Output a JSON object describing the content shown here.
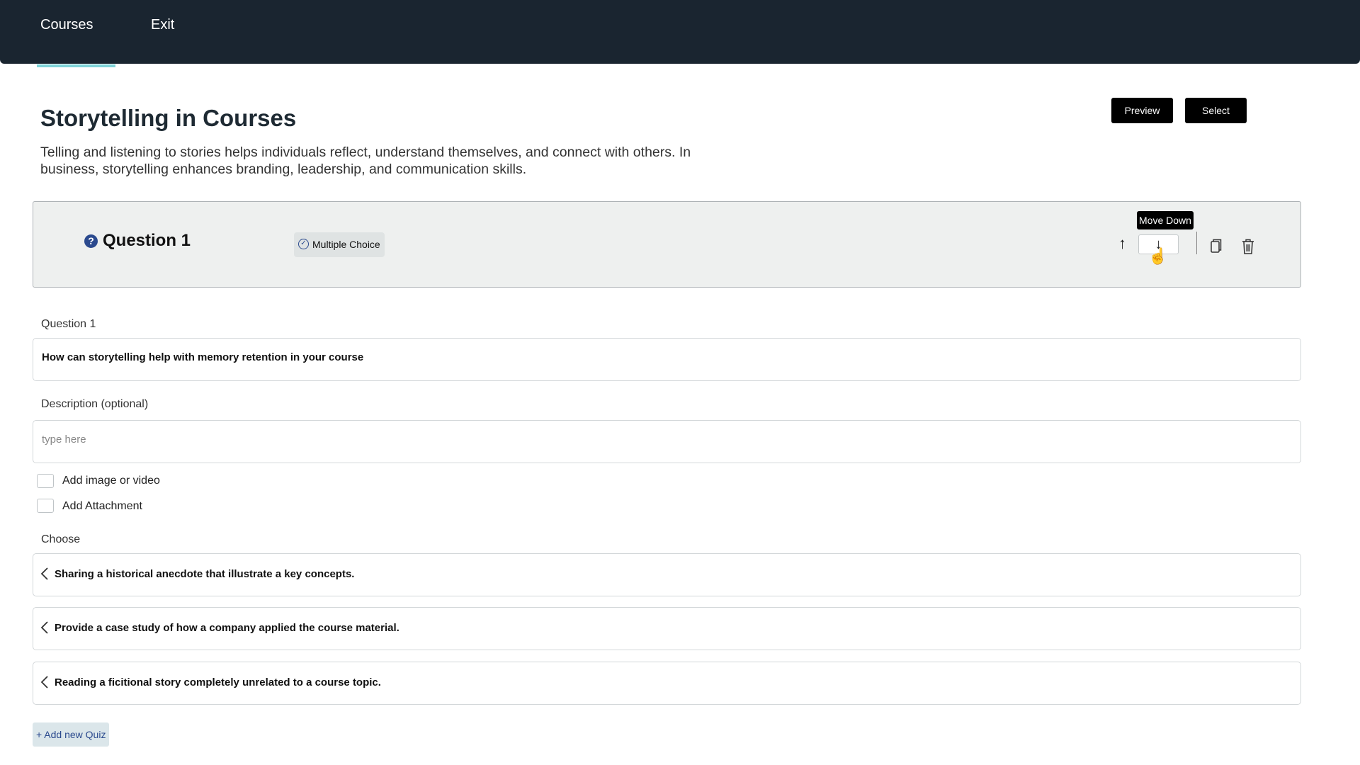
{
  "nav": {
    "courses": "Courses",
    "exit": "Exit"
  },
  "page": {
    "title": "Storytelling in Courses",
    "description": "Telling and listening to stories helps individuals reflect, understand themselves, and connect with others. In business, storytelling enhances branding, leadership, and communication skills."
  },
  "actions": {
    "preview": "Preview",
    "select": "Select"
  },
  "question_header": {
    "help_glyph": "?",
    "title": "Question 1",
    "type": "Multiple Choice",
    "tooltip": "Move Down",
    "move_up_glyph": "↑",
    "move_down_glyph": "↓"
  },
  "form": {
    "question_label": "Question 1",
    "question_value": "How can storytelling help with memory  retention in your course",
    "description_label": "Description (optional)",
    "description_placeholder": "type here",
    "add_media_label": "Add image or video",
    "add_attachment_label": "Add Attachment",
    "choose_label": "Choose"
  },
  "choices": [
    {
      "text": "Sharing a historical anecdote that illustrate a key concepts."
    },
    {
      "text": "Provide a case study of how a company applied the course material."
    },
    {
      "text": "Reading a ficitional story completely unrelated to a course topic."
    }
  ],
  "add_quiz": "+ Add new Quiz",
  "colors": {
    "topbar": "#1a2530",
    "accent": "#7fd3d8",
    "badge_blue": "#2b4a8e",
    "header_bg": "#eef0ef"
  }
}
